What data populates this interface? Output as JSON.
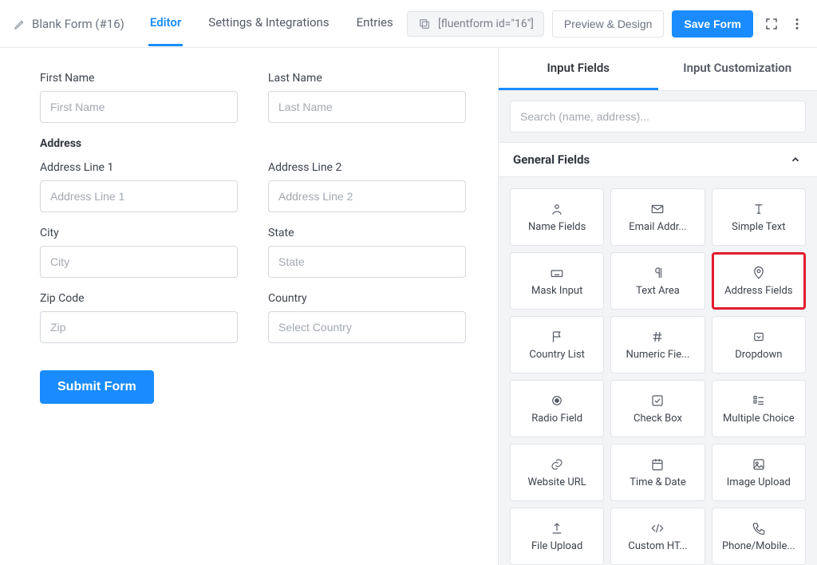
{
  "header": {
    "title": "Blank Form (#16)",
    "tabs": {
      "editor": "Editor",
      "settings": "Settings & Integrations",
      "entries": "Entries"
    },
    "shortcode": "[fluentform id=\"16\"]",
    "preview_btn": "Preview & Design",
    "save_btn": "Save Form"
  },
  "form": {
    "name_first_label": "First Name",
    "name_first_placeholder": "First Name",
    "name_last_label": "Last Name",
    "name_last_placeholder": "Last Name",
    "address_heading": "Address",
    "addr1_label": "Address Line 1",
    "addr1_placeholder": "Address Line 1",
    "addr2_label": "Address Line 2",
    "addr2_placeholder": "Address Line 2",
    "city_label": "City",
    "city_placeholder": "City",
    "state_label": "State",
    "state_placeholder": "State",
    "zip_label": "Zip Code",
    "zip_placeholder": "Zip",
    "country_label": "Country",
    "country_placeholder": "Select Country",
    "submit": "Submit Form"
  },
  "panel": {
    "tabs": {
      "input": "Input Fields",
      "custom": "Input Customization"
    },
    "search_placeholder": "Search (name, address)...",
    "group_general": "General Fields",
    "fields": [
      {
        "name": "Name Fields",
        "icon": "user"
      },
      {
        "name": "Email Addr...",
        "icon": "mail"
      },
      {
        "name": "Simple Text",
        "icon": "text"
      },
      {
        "name": "Mask Input",
        "icon": "keyboard"
      },
      {
        "name": "Text Area",
        "icon": "para"
      },
      {
        "name": "Address Fields",
        "icon": "pin",
        "highlighted": true
      },
      {
        "name": "Country List",
        "icon": "flag"
      },
      {
        "name": "Numeric Fie...",
        "icon": "hash"
      },
      {
        "name": "Dropdown",
        "icon": "drop"
      },
      {
        "name": "Radio Field",
        "icon": "radio"
      },
      {
        "name": "Check Box",
        "icon": "check"
      },
      {
        "name": "Multiple Choice",
        "icon": "list"
      },
      {
        "name": "Website URL",
        "icon": "link"
      },
      {
        "name": "Time & Date",
        "icon": "calendar"
      },
      {
        "name": "Image Upload",
        "icon": "image"
      },
      {
        "name": "File Upload",
        "icon": "upload"
      },
      {
        "name": "Custom HT...",
        "icon": "code"
      },
      {
        "name": "Phone/Mobile...",
        "icon": "phone"
      }
    ]
  }
}
